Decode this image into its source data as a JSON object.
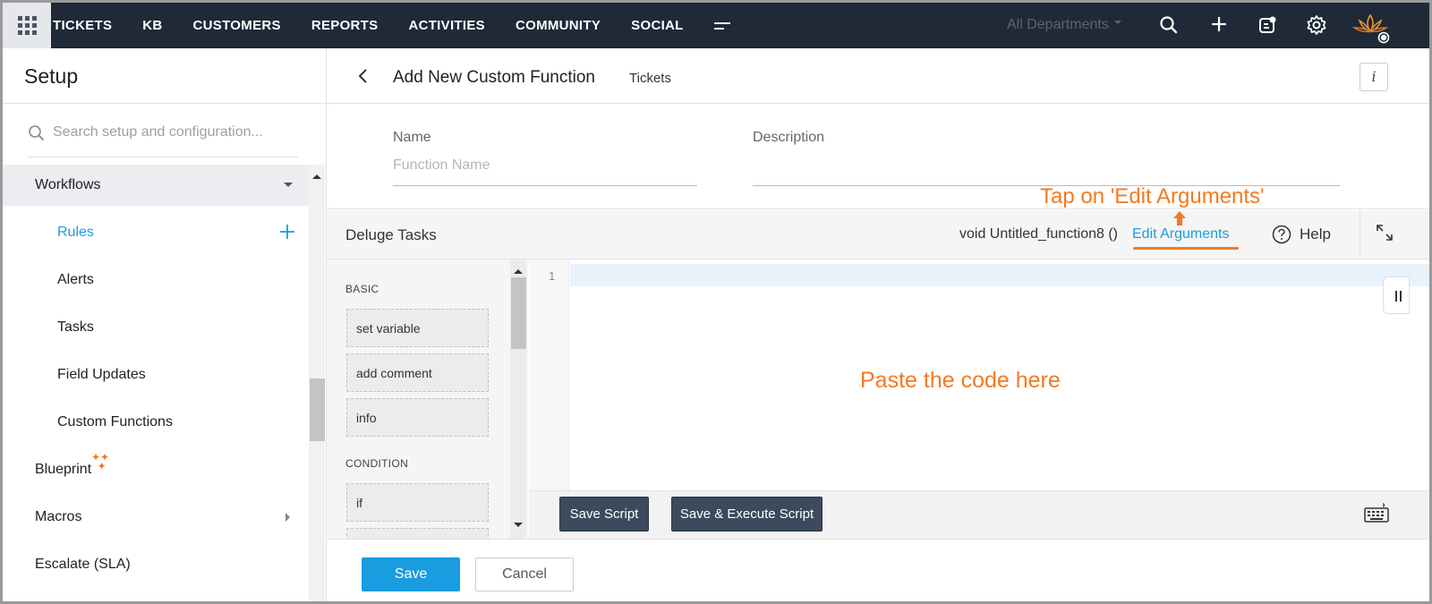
{
  "topbar": {
    "nav": [
      "TICKETS",
      "KB",
      "CUSTOMERS",
      "REPORTS",
      "ACTIVITIES",
      "COMMUNITY",
      "SOCIAL"
    ],
    "department": "All Departments",
    "accent": "#1f2937"
  },
  "sidebar": {
    "title": "Setup",
    "search_placeholder": "Search setup and configuration...",
    "items": [
      {
        "label": "Workflows"
      },
      {
        "label": "Rules"
      },
      {
        "label": "Alerts"
      },
      {
        "label": "Tasks"
      },
      {
        "label": "Field Updates"
      },
      {
        "label": "Custom Functions"
      },
      {
        "label": "Blueprint"
      },
      {
        "label": "Macros"
      },
      {
        "label": "Escalate (SLA)"
      }
    ]
  },
  "header": {
    "title": "Add New Custom Function",
    "module": "Tickets",
    "info_icon": "i"
  },
  "form": {
    "name_label": "Name",
    "name_placeholder": "Function Name",
    "description_label": "Description"
  },
  "annotations": {
    "edit_hint": "Tap on 'Edit Arguments'",
    "paste_hint": "Paste the code here",
    "color": "#f47920"
  },
  "deluge": {
    "title": "Deluge Tasks",
    "signature": "void Untitled_function8 ()",
    "edit_arguments": "Edit Arguments",
    "help": "Help",
    "categories": {
      "basic": "BASIC",
      "condition": "CONDITION"
    },
    "tasks": [
      "set variable",
      "add comment",
      "info",
      "if"
    ]
  },
  "editor": {
    "line_number": "1",
    "save_script": "Save Script",
    "save_execute": "Save & Execute Script"
  },
  "footer": {
    "save": "Save",
    "cancel": "Cancel"
  }
}
